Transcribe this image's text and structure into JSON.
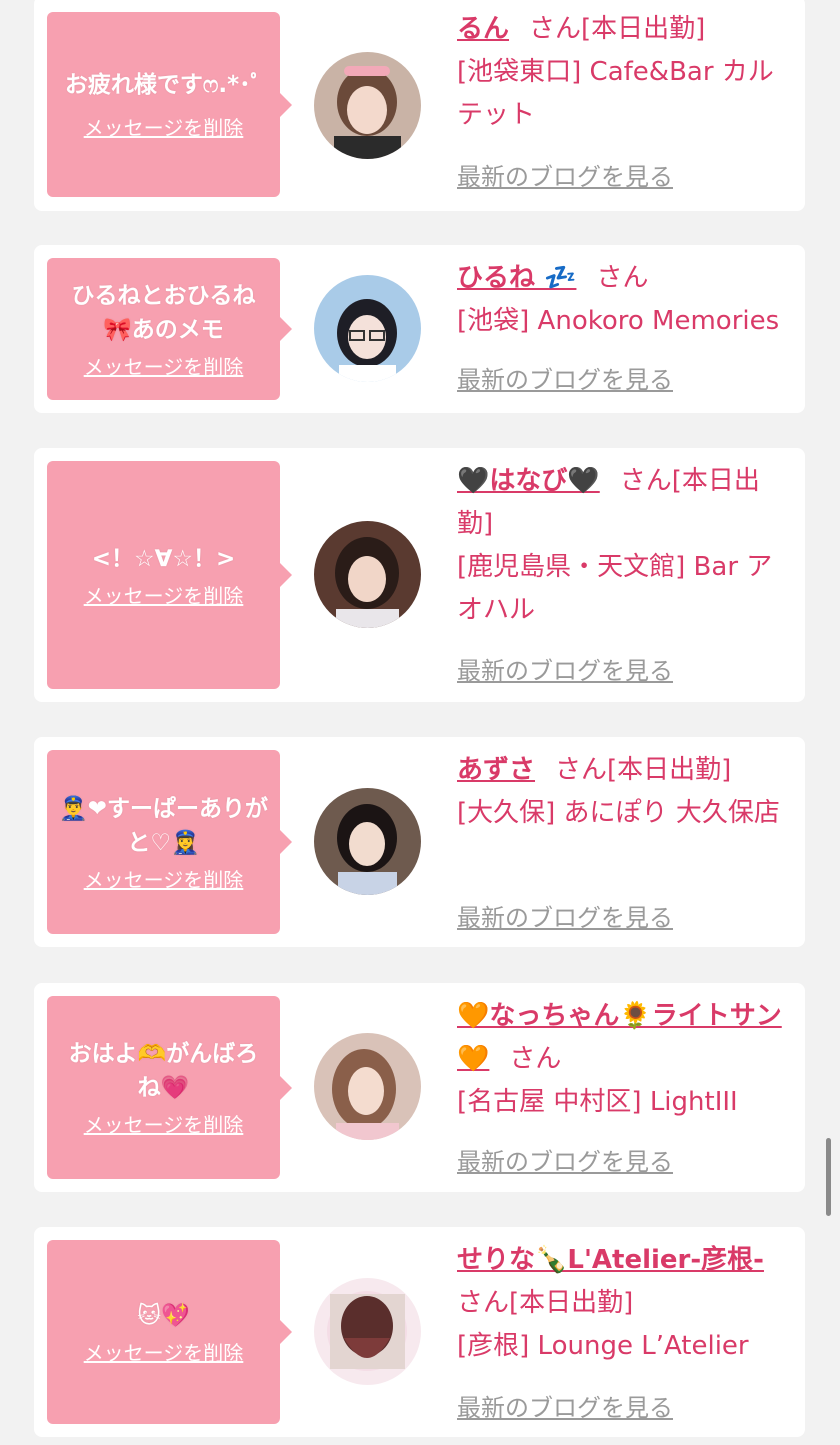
{
  "cards": [
    {
      "bubble_msg": "お疲れ様ですෆ.*･ﾟ",
      "delete_label": "メッセージを削除",
      "name": "るん",
      "san": "さん",
      "status": "[本日出勤]",
      "location": "[池袋東口] Cafe&Bar カルテット",
      "blog_label": "最新のブログを見る"
    },
    {
      "bubble_msg": "ひるねとおひるね🎀あのメモ",
      "delete_label": "メッセージを削除",
      "name": "ひるね 💤",
      "san": "さん",
      "status": "",
      "location": "[池袋] Anokoro Memories",
      "blog_label": "最新のブログを見る"
    },
    {
      "bubble_msg": "<！☆∀☆！>",
      "delete_label": "メッセージを削除",
      "name": "🖤はなび🖤",
      "san": "さん",
      "status": "[本日出勤]",
      "location": "[鹿児島県・天文館] Bar アオハル",
      "blog_label": "最新のブログを見る"
    },
    {
      "bubble_msg": "👮‍♂️❤︎すーぱーありがと♡👮‍♀️",
      "delete_label": "メッセージを削除",
      "name": "あずさ",
      "san": "さん",
      "status": "[本日出勤]",
      "location": "[大久保] あにぽり 大久保店",
      "blog_label": "最新のブログを見る"
    },
    {
      "bubble_msg": "おはよ🫶がんばろね💗",
      "delete_label": "メッセージを削除",
      "name": "🧡なっちゃん🌻ライトサン🧡",
      "san": "さん",
      "status": "",
      "location": "[名古屋 中村区] LightIII",
      "blog_label": "最新のブログを見る"
    },
    {
      "bubble_msg": "🐱💖",
      "delete_label": "メッセージを削除",
      "name": "せりな🍾L'Atelier-彦根-",
      "san": "さん",
      "status": "[本日出勤]",
      "location": "[彦根] Lounge L’Atelier",
      "blog_label": "最新のブログを見る"
    }
  ],
  "colors": {
    "accent": "#d93a68",
    "bubble": "#f7a0b0",
    "muted": "#9a9a9a",
    "background": "#f2f2f2"
  }
}
